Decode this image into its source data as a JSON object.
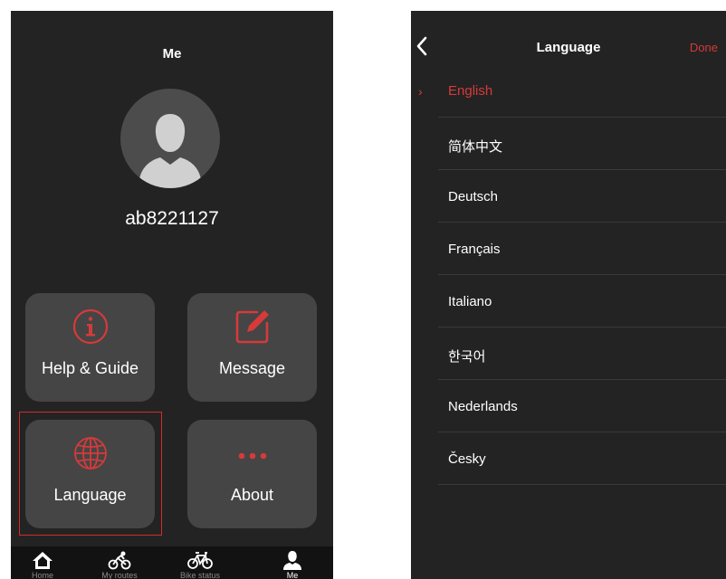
{
  "me": {
    "title": "Me",
    "username": "ab8221127",
    "tiles": [
      {
        "label": "Help & Guide",
        "icon": "info-icon"
      },
      {
        "label": "Message",
        "icon": "edit-icon"
      },
      {
        "label": "Language",
        "icon": "globe-icon"
      },
      {
        "label": "About",
        "icon": "more-dots-icon"
      }
    ],
    "tabs": [
      {
        "label": "Home",
        "icon": "home-icon"
      },
      {
        "label": "My routes",
        "icon": "cyclist-icon"
      },
      {
        "label": "Bike status",
        "icon": "bike-icon"
      },
      {
        "label": "Me",
        "icon": "person-icon",
        "active": true
      }
    ]
  },
  "language": {
    "title": "Language",
    "done": "Done",
    "items": [
      {
        "name": "English",
        "selected": true
      },
      {
        "name": "简体中文"
      },
      {
        "name": "Deutsch"
      },
      {
        "name": "Français"
      },
      {
        "name": "Italiano"
      },
      {
        "name": "한국어"
      },
      {
        "name": "Nederlands"
      },
      {
        "name": "Česky"
      }
    ]
  },
  "colors": {
    "accent": "#d63a3a",
    "background": "#232323",
    "tile": "#454545"
  }
}
